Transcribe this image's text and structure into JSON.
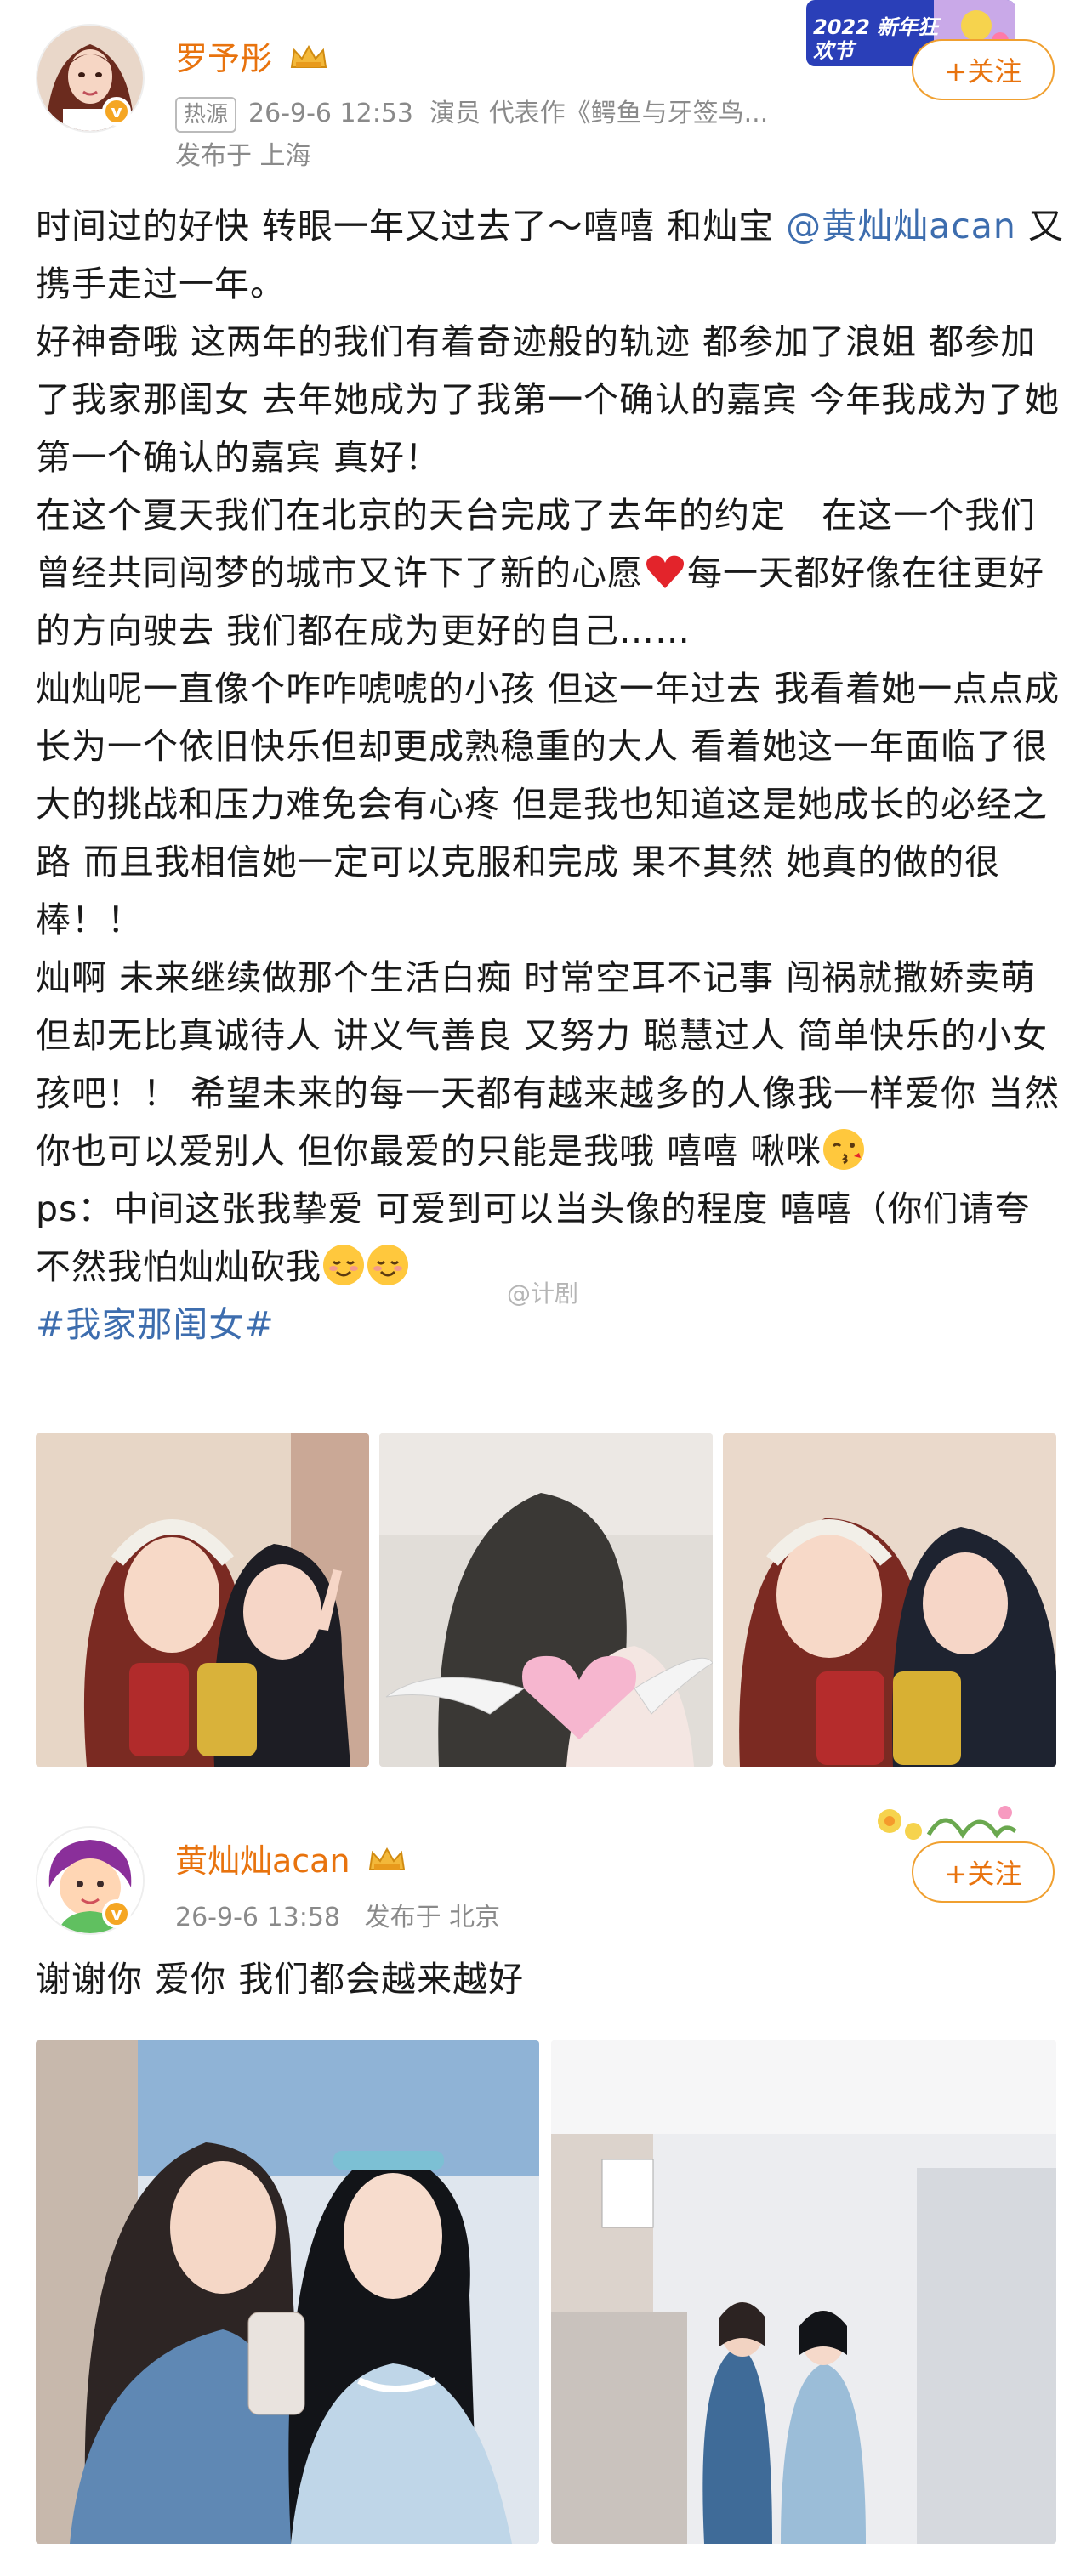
{
  "post1": {
    "username": "罗予彤",
    "hot_tag": "热源",
    "timestamp": "26-9-6 12:53",
    "profession": "演员 代表作《鳄鱼与牙签鸟...",
    "location": "发布于 上海",
    "follow_label": "+关注",
    "badge_text": "2022 新年狂欢节",
    "text_line1": "时间过的好快 转眼一年又过去了～嘻嘻 和灿宝 ",
    "mention": "@黄灿灿acan",
    "text_line2": " 又携手走过一年。",
    "para2": "好神奇哦 这两年的我们有着奇迹般的轨迹 都参加了浪姐 都参加了我家那闺女 去年她成为了我第一个确认的嘉宾 今年我成为了她第一个确认的嘉宾 真好！",
    "para3a": "在这个夏天我们在北京的天台完成了去年的约定   在这一个我们曾经共同闯梦的城市又许下了新的心愿",
    "para3b": "每一天都好像在往更好的方向驶去 我们都在成为更好的自己……",
    "para4": "灿灿呢一直像个咋咋唬唬的小孩 但这一年过去 我看着她一点点成长为一个依旧快乐但却更成熟稳重的大人 看着她这一年面临了很大的挑战和压力难免会有心疼 但是我也知道这是她成长的必经之路 而且我相信她一定可以克服和完成 果不其然 她真的做的很棒！！",
    "para5": "灿啊 未来继续做那个生活白痴 时常空耳不记事 闯祸就撒娇卖萌 但却无比真诚待人 讲义气善良 又努力 聪慧过人 简单快乐的小女孩吧！！ 希望未来的每一天都有越来越多的人像我一样爱你 当然你也可以爱别人 但你最爱的只能是我哦 嘻嘻 啾咪",
    "para6": "ps：中间这张我挚爱 可爱到可以当头像的程度 嘻嘻（你们请夸 不然我怕灿灿砍我",
    "hashtag": "#我家那闺女#",
    "watermark": "@计剧"
  },
  "post2": {
    "username": "黄灿灿acan",
    "timestamp": "26-9-6 13:58",
    "location": "发布于 北京",
    "follow_label": "+关注",
    "text": "谢谢你 爱你 我们都会越来越好"
  },
  "colors": {
    "username": "#e8730e",
    "link": "#3d6dae",
    "meta": "#8a8a8a",
    "follow_border": "#f0a030"
  },
  "icons": [
    "crown-icon",
    "verified-icon",
    "heart-emoji",
    "kiss-emoji",
    "smile-emoji"
  ]
}
